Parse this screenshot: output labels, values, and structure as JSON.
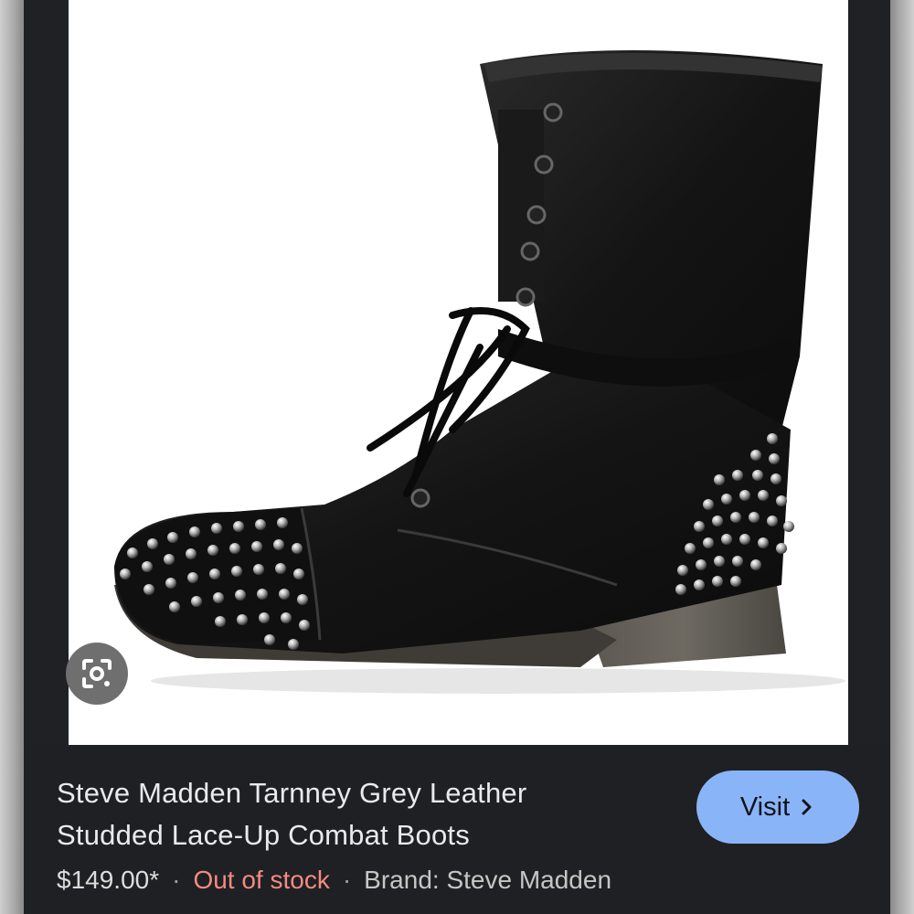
{
  "product": {
    "title_line1": "Steve Madden Tarnney Grey Leather",
    "title_line2": "Studded Lace-Up Combat Boots",
    "price": "$149.00*",
    "separator": "·",
    "stock_status": "Out of stock",
    "brand": "Brand: Steve Madden"
  },
  "actions": {
    "visit_label": "Visit",
    "visit_icon": "chevron-right-icon",
    "lens_icon": "google-lens-icon"
  },
  "colors": {
    "visit_button_bg": "#8ab4f8",
    "stock_status": "#f28b82",
    "panel_bg": "#1f2023"
  }
}
